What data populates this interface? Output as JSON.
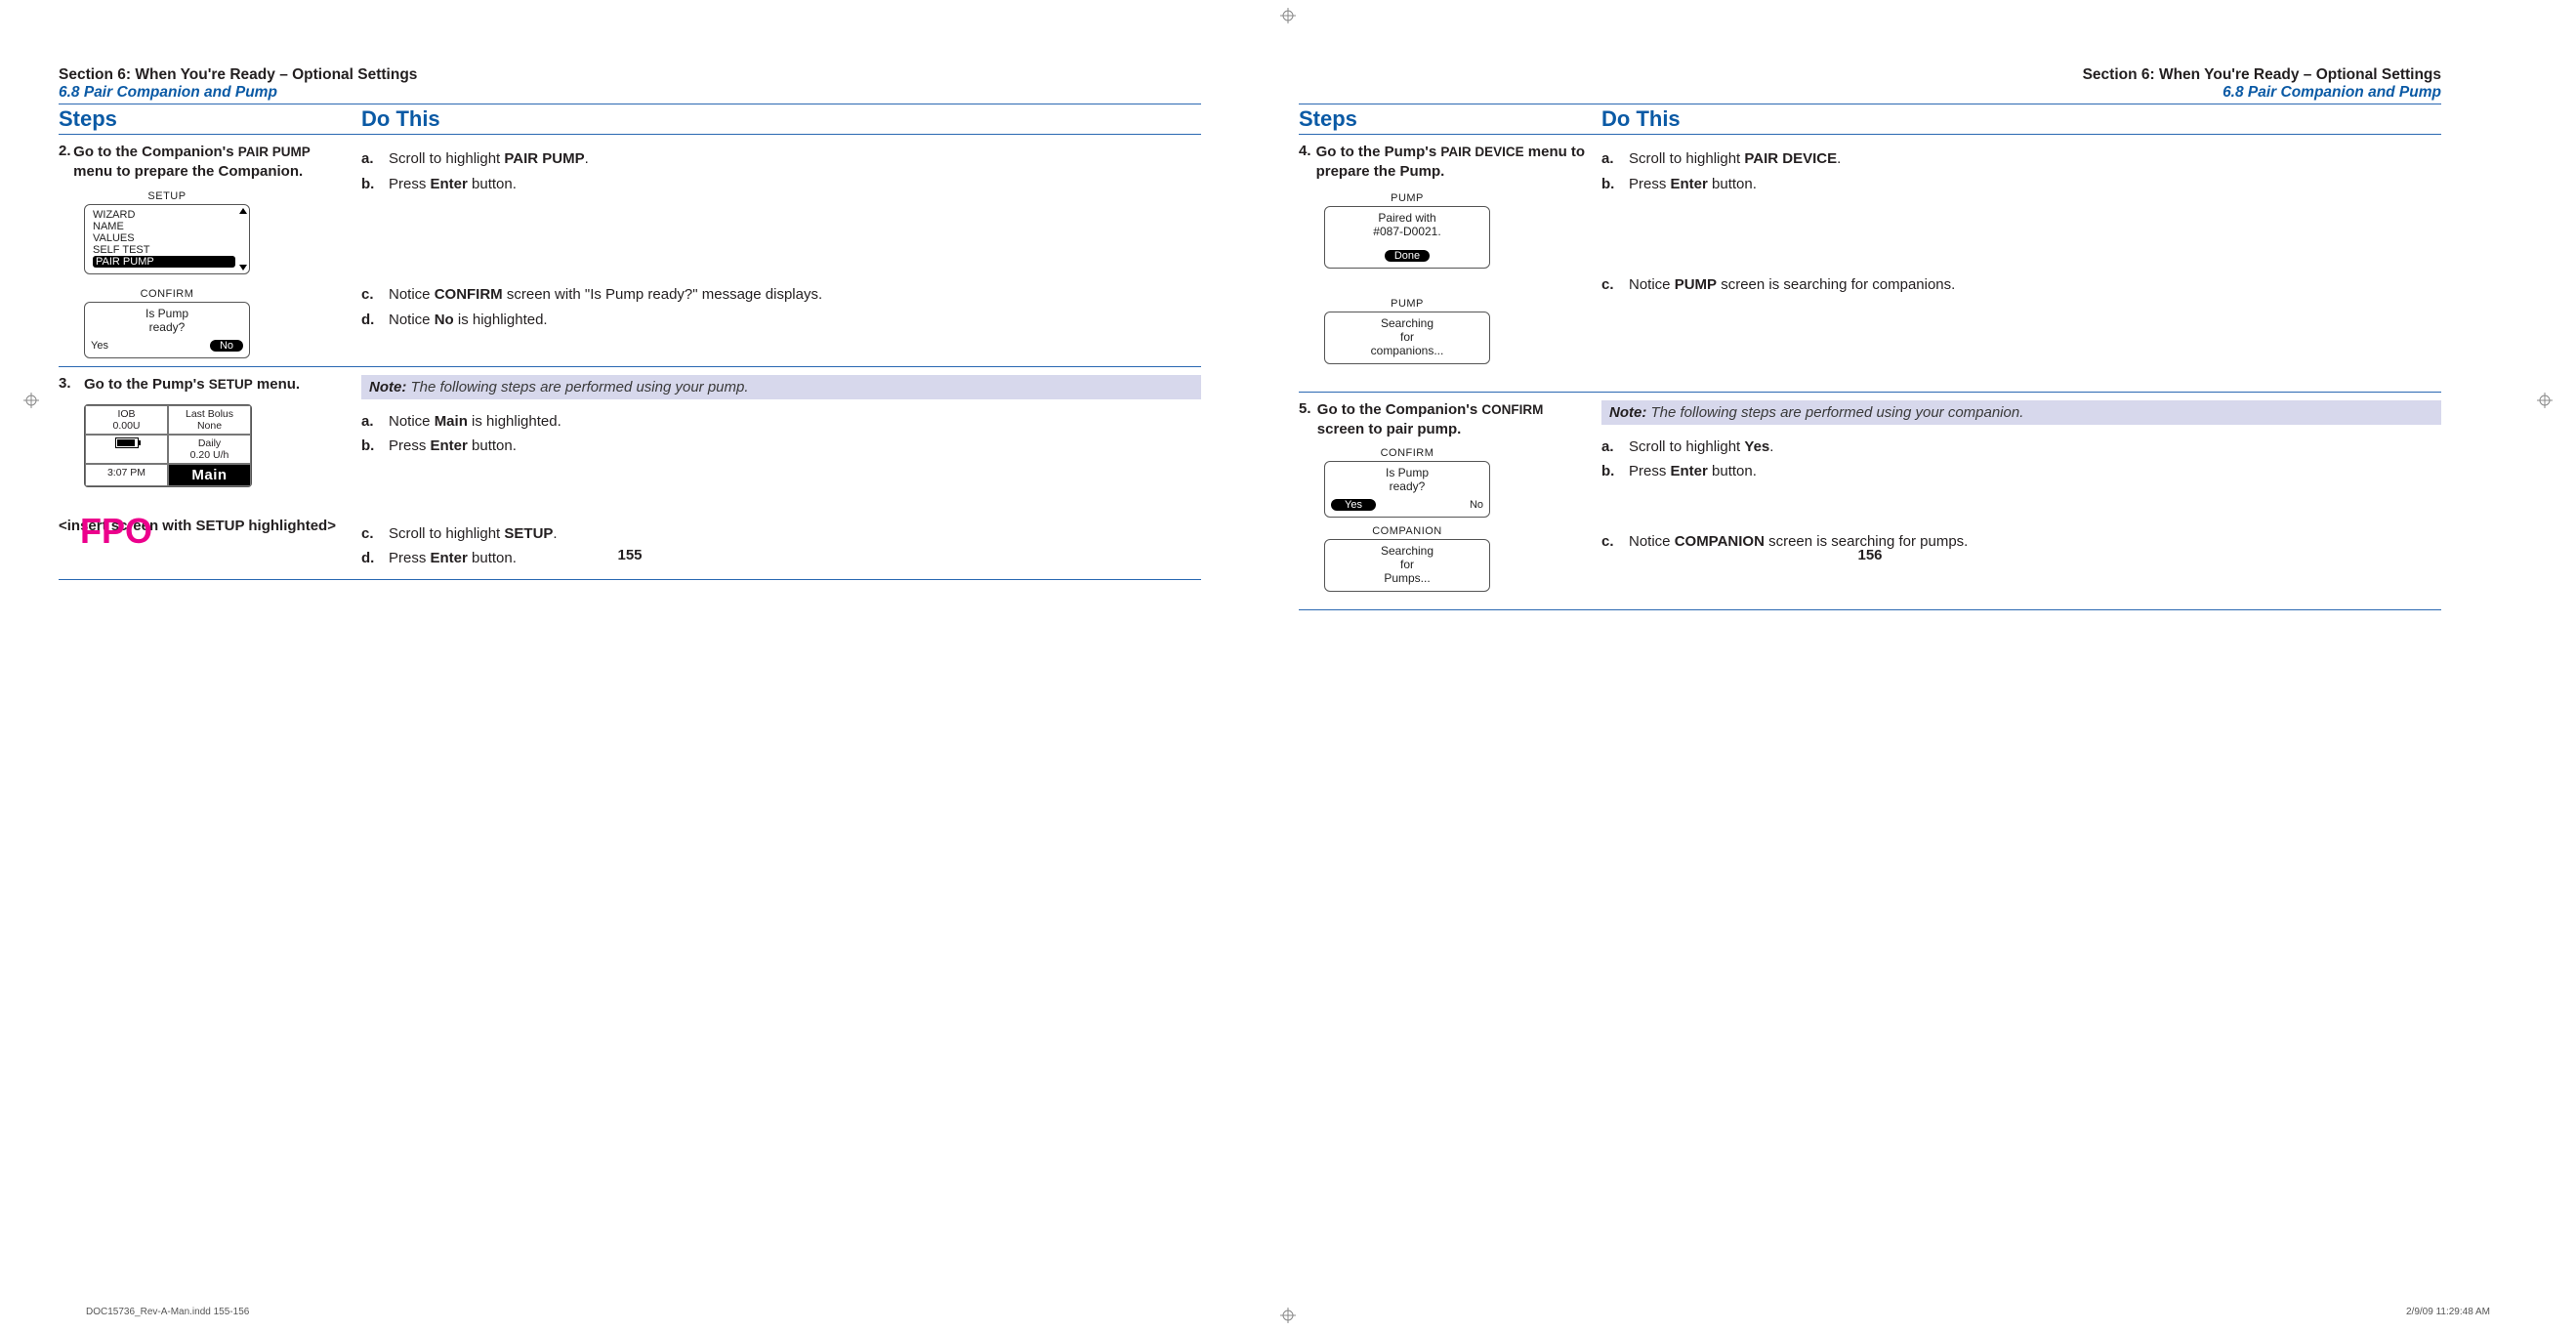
{
  "header": {
    "section_line": "Section 6: When You're Ready – Optional Settings",
    "sub_line": "6.8 Pair Companion and Pump"
  },
  "columns": {
    "steps": "Steps",
    "dothis": "Do This"
  },
  "left_page": {
    "number": "155",
    "step2": {
      "num": "2.",
      "text_a": "Go to the Companion's ",
      "text_b": "PAIR PUMP",
      "text_c": " menu to prepare the Companion.",
      "substeps1": [
        {
          "lbl": "a.",
          "html": "Scroll to highlight <b>PAIR PUMP</b>."
        },
        {
          "lbl": "b.",
          "html": "Press <b>Enter</b> button."
        }
      ],
      "substeps2": [
        {
          "lbl": "c.",
          "html": "Notice <b>CONFIRM</b> screen with \"Is Pump ready?\" message displays."
        },
        {
          "lbl": "d.",
          "html": "Notice <b>No</b> is highlighted."
        }
      ],
      "screen_setup": {
        "title": "SETUP",
        "items": [
          "WIZARD",
          "NAME",
          "VALUES",
          "SELF TEST"
        ],
        "selected": "PAIR PUMP"
      },
      "screen_confirm": {
        "title": "CONFIRM",
        "line1": "Is Pump",
        "line2": "ready?",
        "left": "Yes",
        "right": "No",
        "selected": "right"
      }
    },
    "step3": {
      "num": "3.",
      "text_a": "Go to the Pump's ",
      "text_b": "SETUP",
      "text_c": " menu.",
      "note": "The following steps are performed using your pump.",
      "note_label": "Note:",
      "substeps1": [
        {
          "lbl": "a.",
          "html": "Notice <b>Main</b> is highlighted."
        },
        {
          "lbl": "b.",
          "html": "Press <b>Enter</b> button."
        }
      ],
      "substeps2": [
        {
          "lbl": "c.",
          "html": "Scroll to highlight <b>SETUP</b>."
        },
        {
          "lbl": "d.",
          "html": "Press <b>Enter</b> button."
        }
      ],
      "pump_main": {
        "iob_lbl": "IOB",
        "iob_val": "0.00U",
        "lb_lbl": "Last Bolus",
        "lb_val": "None",
        "daily_lbl": "Daily",
        "daily_val": "0.20 U/h",
        "time": "3:07 PM",
        "big": "Main"
      },
      "fpo_text": "<insert screen with SETUP highlighted>",
      "fpo_overlay": "FPO"
    }
  },
  "right_page": {
    "number": "156",
    "step4": {
      "num": "4.",
      "text_a": "Go to the Pump's ",
      "text_b": "PAIR DEVICE",
      "text_c": " menu to prepare the Pump.",
      "substeps1": [
        {
          "lbl": "a.",
          "html": "Scroll to highlight <b>PAIR DEVICE</b>."
        },
        {
          "lbl": "b.",
          "html": "Press <b>Enter</b> button."
        }
      ],
      "substeps2": [
        {
          "lbl": "c.",
          "html": "Notice <b>PUMP</b> screen is searching for companions."
        }
      ],
      "screen_paired": {
        "title": "PUMP",
        "line1": "Paired with",
        "line2": "#087-D0021.",
        "btn": "Done"
      },
      "screen_search": {
        "title": "PUMP",
        "line1": "Searching",
        "line2": "for",
        "line3": "companions..."
      }
    },
    "step5": {
      "num": "5.",
      "text_a": "Go to the Companion's ",
      "text_b": "CONFIRM",
      "text_c": " screen to pair pump.",
      "note": "The following steps are performed using your companion.",
      "note_label": "Note:",
      "substeps1": [
        {
          "lbl": "a.",
          "html": "Scroll to highlight <b>Yes</b>."
        },
        {
          "lbl": "b.",
          "html": "Press <b>Enter</b> button."
        }
      ],
      "substeps2": [
        {
          "lbl": "c.",
          "html": "Notice <b>COMPANION</b> screen is searching for pumps."
        }
      ],
      "screen_confirm": {
        "title": "CONFIRM",
        "line1": "Is Pump",
        "line2": "ready?",
        "left": "Yes",
        "right": "No",
        "selected": "left"
      },
      "screen_search": {
        "title": "COMPANION",
        "line1": "Searching",
        "line2": "for",
        "line3": "Pumps..."
      }
    }
  },
  "footer": {
    "slug": "DOC15736_Rev-A-Man.indd   155-156",
    "timestamp": "2/9/09   11:29:48 AM"
  }
}
